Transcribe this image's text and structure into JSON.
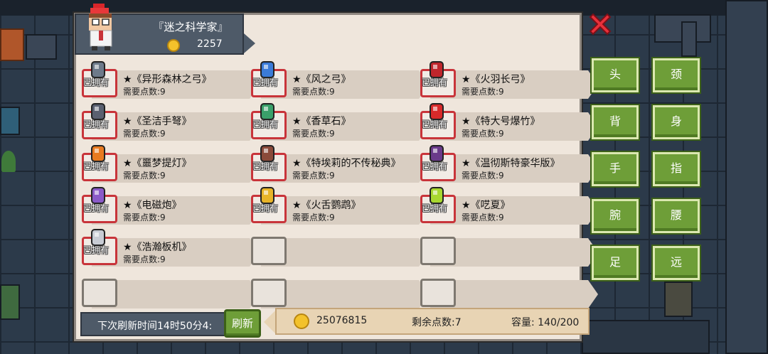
{
  "player": {
    "name": "『迷之科学家』",
    "coins": "2257"
  },
  "items": [
    {
      "name": "★《异形森林之弓》",
      "cost": "需要点数:9",
      "owned": "已拥有",
      "sprite": "alien-forest-bow-icon",
      "color": "#6d7a8a"
    },
    {
      "name": "★《风之弓》",
      "cost": "需要点数:9",
      "owned": "已拥有",
      "sprite": "wind-bow-icon",
      "color": "#3b7bd8"
    },
    {
      "name": "★《火羽长弓》",
      "cost": "需要点数:9",
      "owned": "已拥有",
      "sprite": "fire-feather-longbow-icon",
      "color": "#c0262c"
    },
    {
      "name": "★《圣洁手弩》",
      "cost": "需要点数:9",
      "owned": "已拥有",
      "sprite": "holy-hand-crossbow-icon",
      "color": "#5a6070"
    },
    {
      "name": "★《香草石》",
      "cost": "需要点数:9",
      "owned": "已拥有",
      "sprite": "vanilla-stone-icon",
      "color": "#3aa06a"
    },
    {
      "name": "★《特大号爆竹》",
      "cost": "需要点数:9",
      "owned": "已拥有",
      "sprite": "giant-firecracker-icon",
      "color": "#d82a2a"
    },
    {
      "name": "★《噩梦提灯》",
      "cost": "需要点数:9",
      "owned": "已拥有",
      "sprite": "nightmare-lantern-icon",
      "color": "#e87a20"
    },
    {
      "name": "★《特埃莉的不传秘典》",
      "cost": "需要点数:9",
      "owned": "已拥有",
      "sprite": "secret-tome-icon",
      "color": "#8a4a3a"
    },
    {
      "name": "★《温彻斯特豪华版》",
      "cost": "需要点数:9",
      "owned": "已拥有",
      "sprite": "winchester-deluxe-icon",
      "color": "#6a3a8a"
    },
    {
      "name": "★《电磁炮》",
      "cost": "需要点数:9",
      "owned": "已拥有",
      "sprite": "railgun-icon",
      "color": "#8a5ac8"
    },
    {
      "name": "★《火舌鹦鹉》",
      "cost": "需要点数:9",
      "owned": "已拥有",
      "sprite": "fire-parrot-icon",
      "color": "#e8b428"
    },
    {
      "name": "★《呓夏》",
      "cost": "需要点数:9",
      "owned": "已拥有",
      "sprite": "summer-dream-gun-icon",
      "color": "#a8d830"
    },
    {
      "name": "★《浩瀚板机》",
      "cost": "需要点数:9",
      "owned": "已拥有",
      "sprite": "vast-trigger-icon",
      "color": "#c8ccd4"
    }
  ],
  "footer": {
    "refresh_text": "下次刷新时间14时50分4:",
    "refresh_button": "刷新",
    "total_coins": "25076815",
    "points_left": "剩余点数:7",
    "capacity": "容量:  140/200"
  },
  "categories": [
    "头",
    "颈",
    "背",
    "身",
    "手",
    "指",
    "腕",
    "腰",
    "足",
    "远"
  ],
  "colors": {
    "panel": "#efe6dc",
    "header": "#4e5a68",
    "button_green": "#6e9e38",
    "owned_border": "#c8343a",
    "coin": "#f3c22b"
  }
}
